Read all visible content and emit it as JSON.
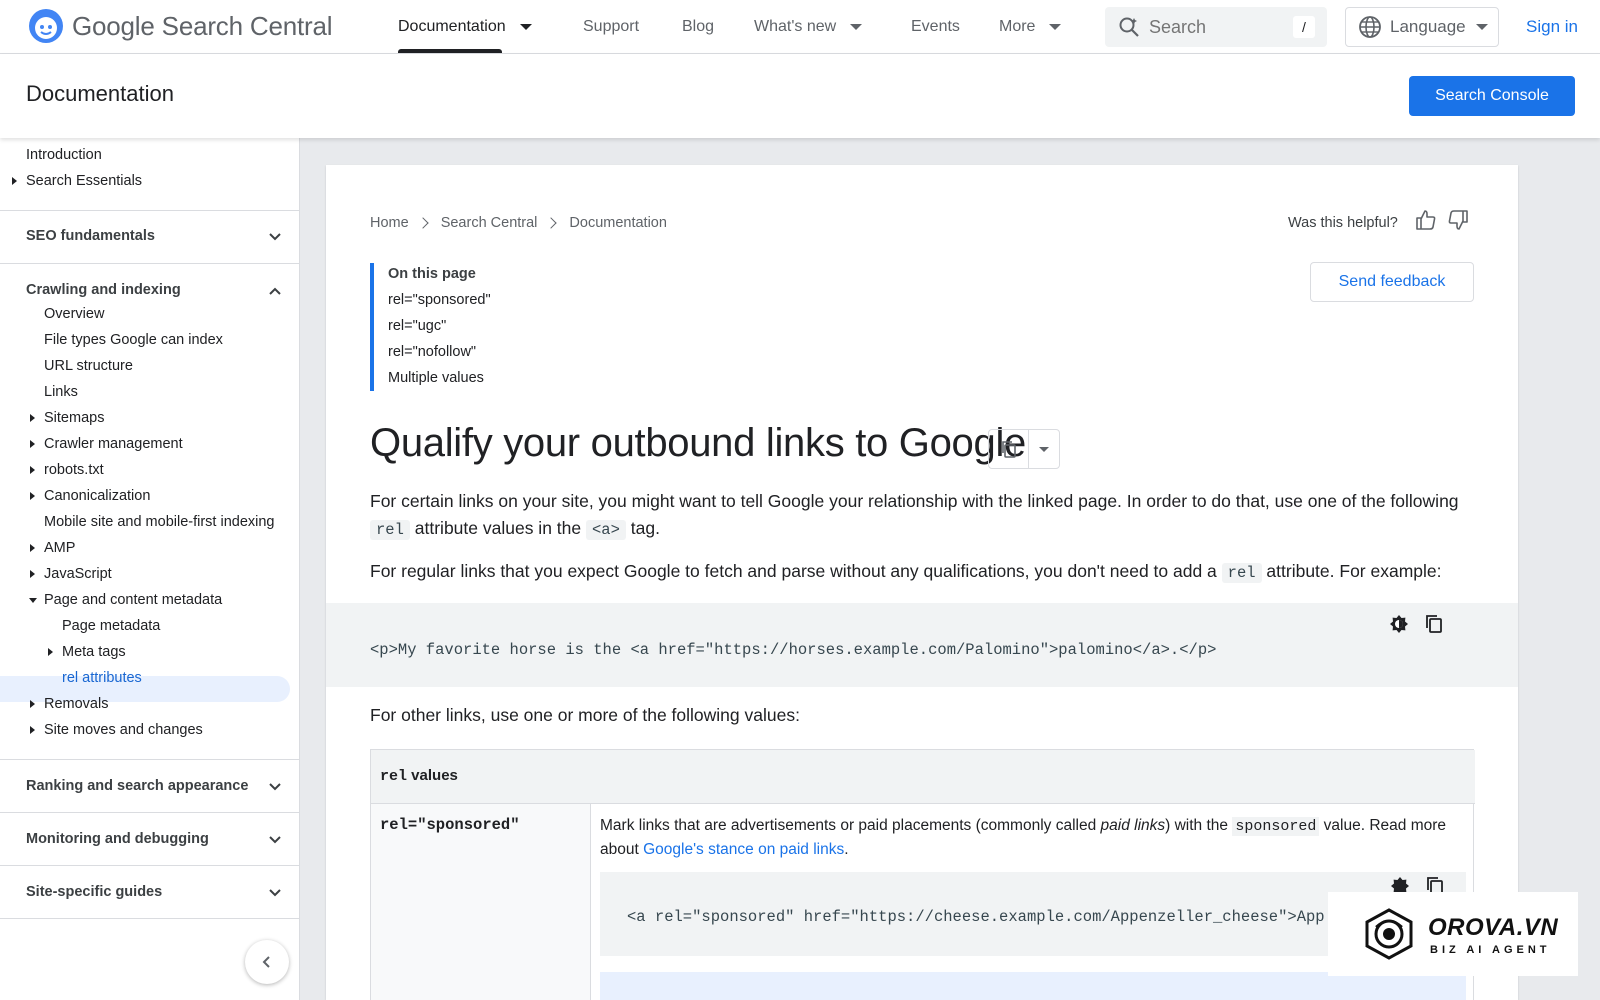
{
  "brand": {
    "name_g": "Google",
    "name_rest": "Search Central"
  },
  "nav": {
    "items": [
      "Documentation",
      "Support",
      "Blog",
      "What's new",
      "Events",
      "More"
    ]
  },
  "search": {
    "placeholder": "Search",
    "shortcut": "/"
  },
  "language_label": "Language",
  "signin_label": "Sign in",
  "subheader": {
    "title": "Documentation",
    "console_button": "Search Console"
  },
  "sidebar": {
    "top_items": [
      "Introduction",
      "Search Essentials"
    ],
    "sections": [
      "SEO fundamentals",
      "Crawling and indexing",
      "Ranking and search appearance",
      "Monitoring and debugging",
      "Site-specific guides"
    ],
    "crawling_items": [
      "Overview",
      "File types Google can index",
      "URL structure",
      "Links",
      "Sitemaps",
      "Crawler management",
      "robots.txt",
      "Canonicalization",
      "Mobile site and mobile-first indexing",
      "AMP",
      "JavaScript",
      "Page and content metadata",
      "Page metadata",
      "Meta tags",
      "rel attributes",
      "Removals",
      "Site moves and changes"
    ]
  },
  "breadcrumb": [
    "Home",
    "Search Central",
    "Documentation"
  ],
  "helpful_label": "Was this helpful?",
  "toc": {
    "heading": "On this page",
    "items": [
      "rel=\"sponsored\"",
      "rel=\"ugc\"",
      "rel=\"nofollow\"",
      "Multiple values"
    ]
  },
  "feedback_label": "Send feedback",
  "page_title": "Qualify your outbound links to Google",
  "intro": {
    "p1_a": "For certain links on your site, you might want to tell Google your relationship with the linked page. In order to do that, use one of the following ",
    "p1_code1": "rel",
    "p1_b": " attribute values in the ",
    "p1_code2": "<a>",
    "p1_c": " tag.",
    "p2_a": "For regular links that you expect Google to fetch and parse without any qualifications, you don't need to add a ",
    "p2_code": "rel",
    "p2_b": " attribute. For example:",
    "example_code": "<p>My favorite horse is the <a href=\"https://horses.example.com/Palomino\">palomino</a>.</p>",
    "p3": "For other links, use one or more of the following values:"
  },
  "table": {
    "header_code": "rel",
    "header_text": " values",
    "row1_code": "rel=\"sponsored\"",
    "row1_desc_a": "Mark links that are advertisements or paid placements (commonly called ",
    "row1_desc_em": "paid links",
    "row1_desc_b": ") with the ",
    "row1_desc_code": "sponsored",
    "row1_desc_c": " value. Read more about ",
    "row1_link": "Google's stance on paid links",
    "row1_desc_d": ".",
    "row1_code_example": "<a rel=\"sponsored\" href=\"https://cheese.example.com/Appenzeller_cheese\">App"
  },
  "badge": {
    "line1": "OROVA.VN",
    "line2": "BIZ AI AGENT"
  },
  "colors": {
    "accent": "#1a73e8",
    "selected_bg": "#e8f0fe",
    "code_bg": "#f1f3f4"
  }
}
